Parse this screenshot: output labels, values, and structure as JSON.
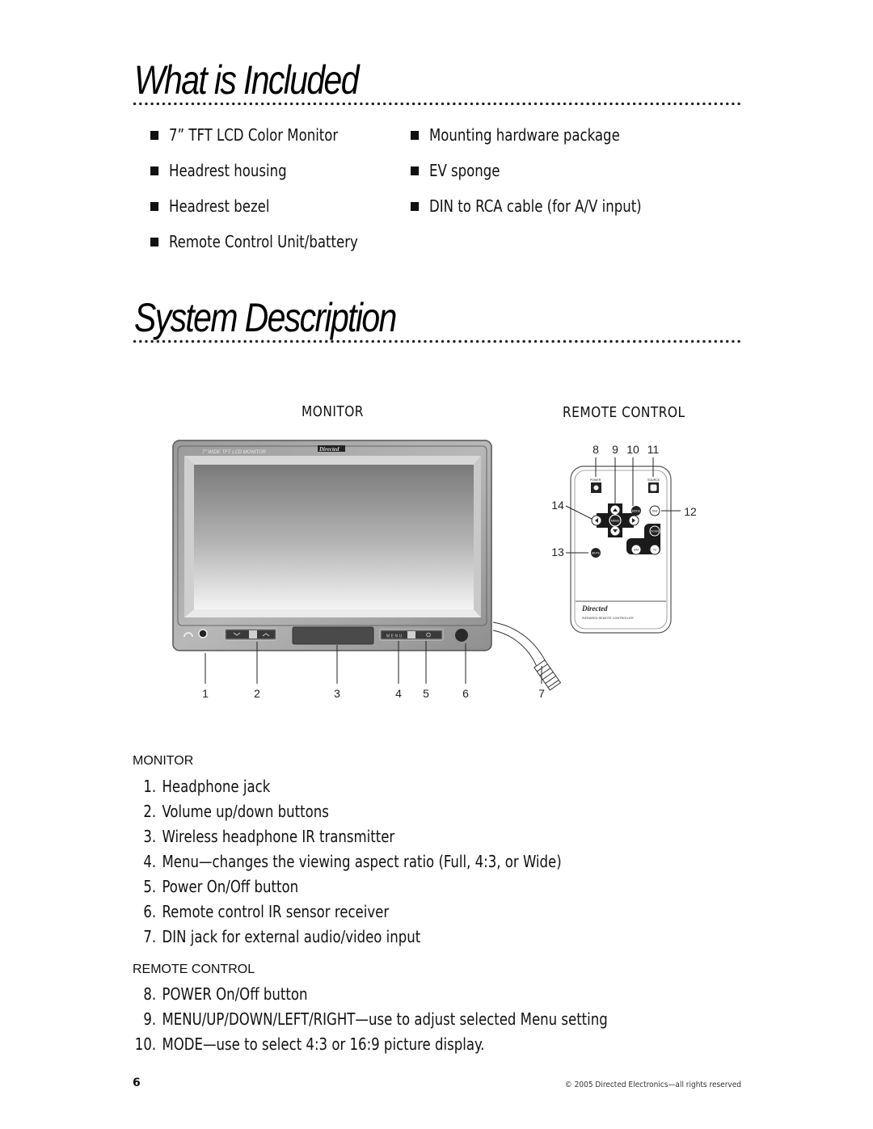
{
  "sections": {
    "included": {
      "title": "What is Included",
      "left_items": [
        "7” TFT LCD Color Monitor",
        "Headrest housing",
        "Headrest bezel",
        "Remote Control Unit/battery"
      ],
      "right_items": [
        "Mounting hardware package",
        "EV sponge",
        "DIN to RCA cable (for A/V input)"
      ]
    },
    "system": {
      "title": "System Description",
      "figure_labels": {
        "monitor": "MONITOR",
        "remote": "REMOTE CONTROL"
      },
      "monitor_image": {
        "bezel_text": "7\" WIDE TFT LCD MONITOR",
        "brand": "Directed",
        "menu_button": "MENU",
        "callouts": [
          "1",
          "2",
          "3",
          "4",
          "5",
          "6",
          "7"
        ]
      },
      "remote_image": {
        "brand": "Directed",
        "subtitle": "INFRARED REMOTE CONTROLLER",
        "buttons": {
          "power": "POWER",
          "source": "SOURCE",
          "mode": "MODE",
          "dim": "DIM",
          "menu": "MENU",
          "scan": "SCAN",
          "mute": "MUTE",
          "am": "A/M",
          "t2": "T2"
        },
        "callouts": {
          "top": [
            "8",
            "9",
            "10",
            "11"
          ],
          "c12": "12",
          "c13": "13",
          "c14": "14"
        }
      }
    },
    "monitor_list": {
      "heading": "MONITOR",
      "items": [
        {
          "num": "1.",
          "text": "Headphone jack"
        },
        {
          "num": "2.",
          "text": "Volume up/down buttons"
        },
        {
          "num": "3.",
          "text": "Wireless headphone IR transmitter"
        },
        {
          "num": "4.",
          "text": "Menu—changes the viewing aspect ratio (Full, 4:3, or Wide)"
        },
        {
          "num": "5.",
          "text": "Power On/Off button"
        },
        {
          "num": "6.",
          "text": "Remote control IR sensor receiver"
        },
        {
          "num": "7.",
          "text": "DIN jack for external audio/video input"
        }
      ]
    },
    "remote_list": {
      "heading": "REMOTE CONTROL",
      "items": [
        {
          "num": "8.",
          "text": "POWER On/Off button"
        },
        {
          "num": "9.",
          "text": "MENU/UP/DOWN/LEFT/RIGHT—use to adjust selected Menu setting"
        },
        {
          "num": "10.",
          "text": "MODE—use to select 4:3 or 16:9 picture display."
        }
      ]
    }
  },
  "footer": {
    "page_number": "6",
    "copyright": "© 2005 Directed Electronics—all rights reserved"
  }
}
